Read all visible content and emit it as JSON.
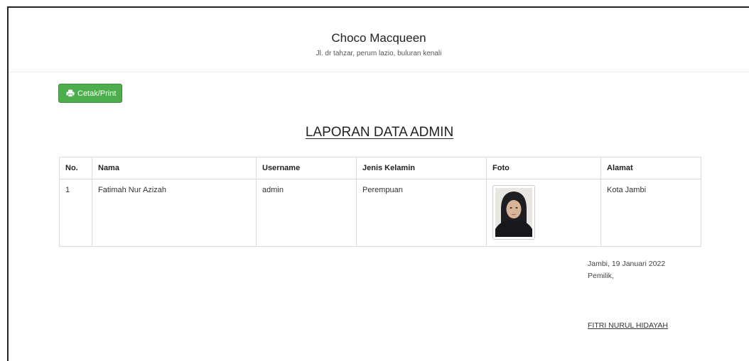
{
  "header": {
    "title": "Choco Macqueen",
    "address": "Jl. dr tahzar, perum lazio, buluran kenali"
  },
  "toolbar": {
    "print_label": "Cetak/Print",
    "print_icon": "print-icon"
  },
  "report": {
    "title": "LAPORAN DATA ADMIN"
  },
  "table": {
    "columns": [
      "No.",
      "Nama",
      "Username",
      "Jenis Kelamin",
      "Foto",
      "Alamat"
    ],
    "rows": [
      {
        "no": "1",
        "nama": "Fatimah Nur Azizah",
        "username": "admin",
        "jenis_kelamin": "Perempuan",
        "alamat": "Kota Jambi"
      }
    ]
  },
  "signature": {
    "date": "Jambi, 19 Januari 2022",
    "role": "Pemilik,",
    "name": "FITRI NURUL HIDAYAH"
  },
  "colors": {
    "button_green": "#4cae4c",
    "frame_border": "#222222"
  }
}
